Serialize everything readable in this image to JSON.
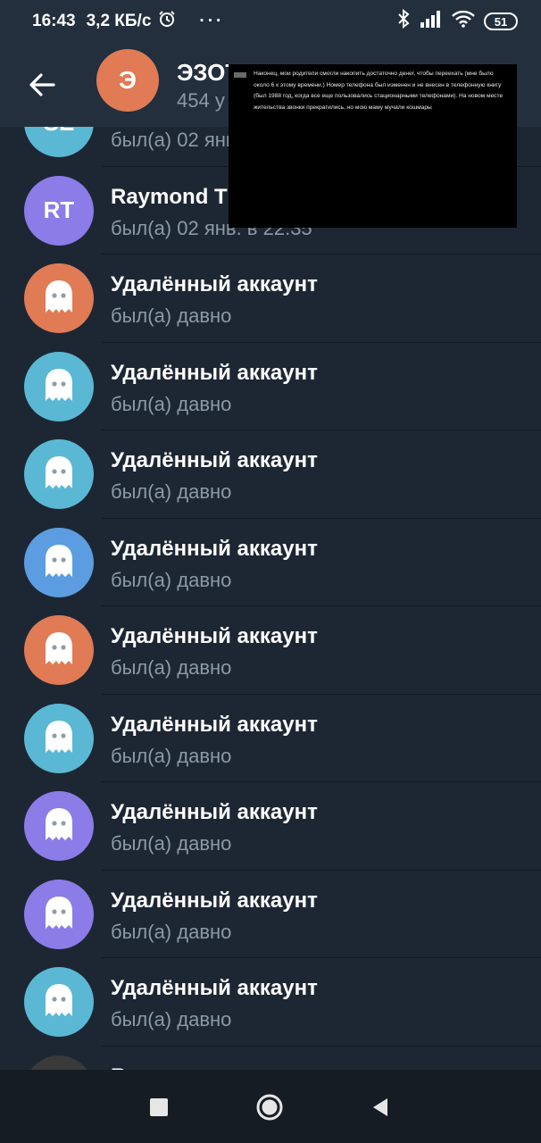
{
  "status_bar": {
    "time": "16:43",
    "speed": "3,2 КБ/с",
    "dots": "···",
    "battery": "51",
    "icons": [
      "alarm-icon",
      "bluetooth-icon",
      "signal-icon",
      "wifi-icon",
      "battery-icon"
    ]
  },
  "header": {
    "avatar_letter": "Э",
    "title": "ЭЗОТ",
    "subtitle": "454 у"
  },
  "overlay": {
    "text": "Наконец, мои родители смогли накопить достаточно денег, чтобы переехать (мне было около 6 к этому времени.) Номер телефона был изменен и не внесен в телефонную книгу (был 1988 год, когда все еще пользовались стационарными телефонами). На новом месте жительства звонки прекратились, но мою маму мучали кошмары"
  },
  "members": [
    {
      "initials": "SE",
      "name": "",
      "seen": "был(а) 02 янв",
      "color": "#5ab8d4"
    },
    {
      "initials": "RT",
      "name": "Raymond T",
      "seen": "был(а) 02 янв. в 22:35",
      "color": "#8b7ce8"
    },
    {
      "initials": "",
      "name": "Удалённый аккаунт",
      "seen": "был(а) давно",
      "color": "#e07b55"
    },
    {
      "initials": "",
      "name": "Удалённый аккаунт",
      "seen": "был(а) давно",
      "color": "#5ab8d4"
    },
    {
      "initials": "",
      "name": "Удалённый аккаунт",
      "seen": "был(а) давно",
      "color": "#5ab8d4"
    },
    {
      "initials": "",
      "name": "Удалённый аккаунт",
      "seen": "был(а) давно",
      "color": "#5b9de0"
    },
    {
      "initials": "",
      "name": "Удалённый аккаунт",
      "seen": "был(а) давно",
      "color": "#e07b55"
    },
    {
      "initials": "",
      "name": "Удалённый аккаунт",
      "seen": "был(а) давно",
      "color": "#5ab8d4"
    },
    {
      "initials": "",
      "name": "Удалённый аккаунт",
      "seen": "был(а) давно",
      "color": "#8b7ce8"
    },
    {
      "initials": "",
      "name": "Удалённый аккаунт",
      "seen": "был(а) давно",
      "color": "#8b7ce8"
    },
    {
      "initials": "",
      "name": "Удалённый аккаунт",
      "seen": "был(а) давно",
      "color": "#5ab8d4"
    },
    {
      "initials": "",
      "name": "R",
      "seen": "",
      "color": "#3a3a3a"
    }
  ],
  "colors": {
    "background": "#1d2733",
    "header": "#232f3d",
    "secondary_text": "#8c9aa8",
    "nav_bar": "#161c24"
  }
}
